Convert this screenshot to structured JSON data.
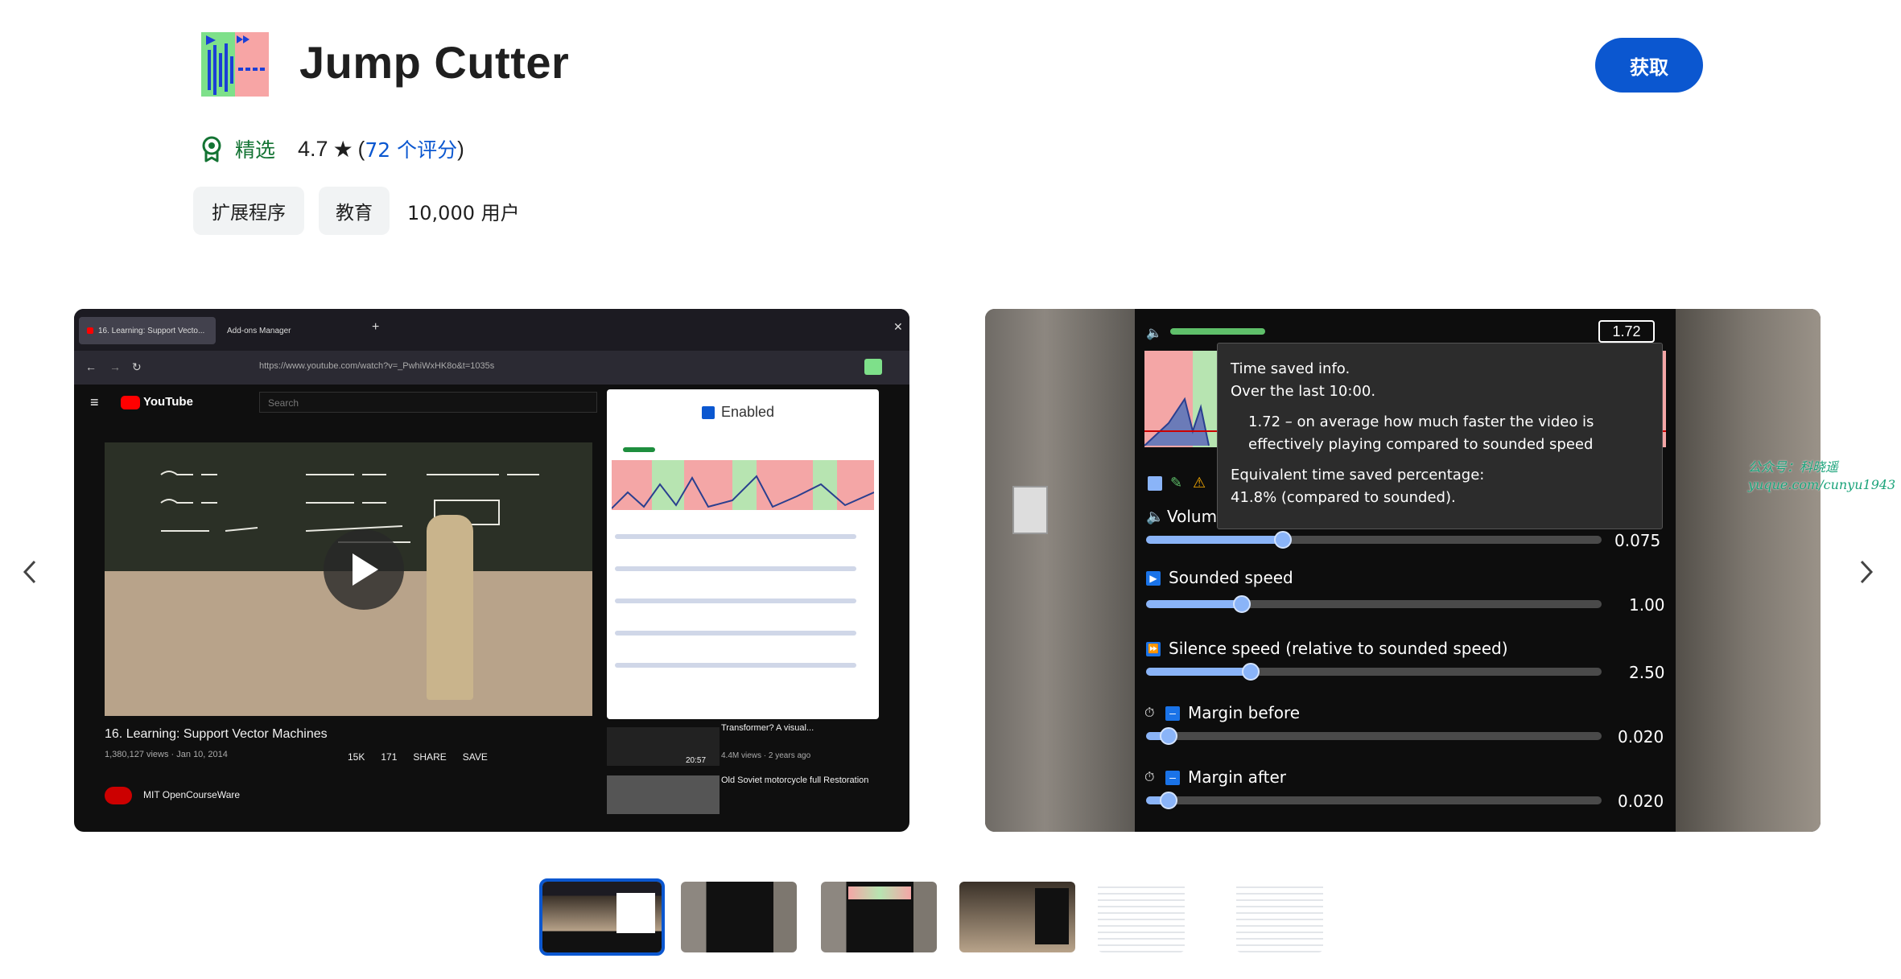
{
  "header": {
    "title": "Jump Cutter",
    "get_button": "获取",
    "featured_label": "精选",
    "rating": "4.7",
    "star": "★",
    "reviews_open": "(",
    "reviews_link": "72 个评分",
    "reviews_close": ")",
    "chips": [
      "扩展程序",
      "教育"
    ],
    "users": "10,000 用户"
  },
  "carousel": {
    "prev_icon": "chevron-left-icon",
    "next_icon": "chevron-right-icon",
    "shot1": {
      "tab1": "16. Learning: Support Vecto...",
      "tab2": "Add-ons Manager",
      "url": "https://www.youtube.com/watch?v=_PwhiWxHK8o&t=1035s",
      "yt_logo": "YouTube",
      "search_placeholder": "Search",
      "video_title": "16. Learning: Support Vector Machines",
      "video_views": "1,380,127 views · Jan 10, 2014",
      "likes": "15K",
      "dislikes": "171",
      "share": "SHARE",
      "save": "SAVE",
      "channel": "MIT OpenCourseWare",
      "popup_enabled": "Enabled",
      "side_title_1": "Transformer? A visual...",
      "side_meta_1": "4.4M views · 2 years ago",
      "side_title_2": "Old Soviet motorcycle full Restoration",
      "duration": "20:57"
    },
    "shot2": {
      "time_saved_badge": "1.72",
      "tooltip_line1": "Time saved info.",
      "tooltip_line2": "Over the last 10:00.",
      "tooltip_line3": "1.72 – on average how much faster the video is",
      "tooltip_line4": "effectively playing compared to sounded speed",
      "tooltip_line5": "Equivalent time saved percentage:",
      "tooltip_line6": "41.8% (compared to sounded).",
      "volume_label": "Volume",
      "volume_value": "0.075",
      "volume_level": 0.3,
      "sounded_label": "Sounded speed",
      "sounded_value": "1.00",
      "sounded_level": 0.21,
      "silence_label": "Silence speed (relative to sounded speed)",
      "silence_value": "2.50",
      "silence_level": 0.23,
      "margin_before_label": "Margin before",
      "margin_before_value": "0.020",
      "margin_before_level": 0.05,
      "margin_after_label": "Margin after",
      "margin_after_value": "0.020",
      "margin_after_level": 0.05
    }
  },
  "watermark": {
    "line1": "公众号：科晓遥",
    "line2": "yuque.com/cunyu1943"
  },
  "colors": {
    "accent": "#0b57d0",
    "featured": "#137333",
    "slider": "#8ab4f8"
  }
}
